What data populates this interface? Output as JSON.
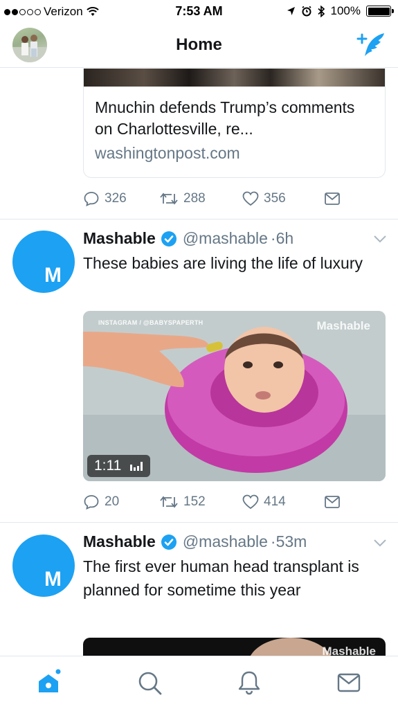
{
  "status_bar": {
    "carrier": "Verizon",
    "time": "7:53 AM",
    "battery": "100%"
  },
  "nav": {
    "title": "Home"
  },
  "colors": {
    "accent": "#1da1f2",
    "secondary_text": "#657786",
    "border": "#e1e8ed"
  },
  "tweets": [
    {
      "card": {
        "title": "Mnuchin defends Trump’s comments on Charlottesville, re...",
        "domain": "washingtonpost.com"
      },
      "actions": {
        "replies": "326",
        "retweets": "288",
        "likes": "356"
      }
    },
    {
      "author": "Mashable",
      "handle": "@mashable",
      "time": "·6h",
      "avatar_letter": "M",
      "text": "These babies are living the life of luxury",
      "media": {
        "credit": "INSTAGRAM / @BABYSPAPERTH",
        "watermark": "Mashable",
        "duration": "1:11"
      },
      "actions": {
        "replies": "20",
        "retweets": "152",
        "likes": "414"
      }
    },
    {
      "author": "Mashable",
      "handle": "@mashable",
      "time": "·53m",
      "avatar_letter": "M",
      "text": "The first ever human head transplant is planned for sometime this year",
      "media": {
        "watermark": "Mashable"
      }
    }
  ],
  "tabs": [
    {
      "name": "home",
      "icon": "home-icon",
      "active": true
    },
    {
      "name": "search",
      "icon": "search-icon"
    },
    {
      "name": "notifications",
      "icon": "bell-icon"
    },
    {
      "name": "messages",
      "icon": "mail-icon"
    }
  ]
}
